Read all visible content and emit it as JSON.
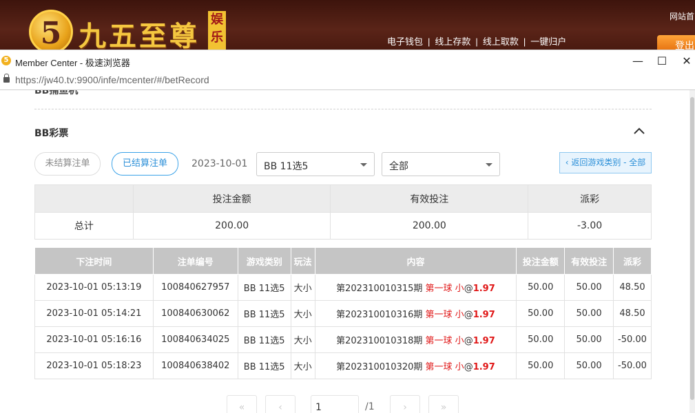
{
  "site": {
    "logo_digit": "5",
    "logo_text": "九五至尊",
    "logo_sub": "娱乐",
    "links": [
      "电子钱包",
      "线上存款",
      "线上取款",
      "一键归户"
    ],
    "link_sep": "|",
    "home_label": "网站首",
    "login_label": "登出"
  },
  "browser": {
    "title": "Member Center - 极速浏览器",
    "url_host": "https://jw40.tv",
    "url_rest": ":9900/infe/mcenter/#/betRecord",
    "minimize": "—",
    "maximize": "☐",
    "close": "✕"
  },
  "page": {
    "prev_section": "BB捕鱼机",
    "section_title": "BB彩票",
    "filters": {
      "unsettled_label": "未结算注单",
      "settled_label": "已结算注单",
      "date": "2023-10-01",
      "game_select": "BB 11选5",
      "type_select": "全部",
      "back_label": "‹ 返回游戏类别 - 全部"
    },
    "summary": {
      "headers": [
        "",
        "投注金额",
        "有效投注",
        "派彩"
      ],
      "row": {
        "label": "总计",
        "bet": "200.00",
        "valid": "200.00",
        "payout": "-3.00"
      }
    },
    "records": {
      "headers": [
        "下注时间",
        "注单编号",
        "游戏类别",
        "玩法",
        "内容",
        "投注金额",
        "有效投注",
        "派彩"
      ],
      "rows": [
        {
          "time": "2023-10-01 05:13:19",
          "id": "100840627957",
          "game": "BB 11选5",
          "play": "大小",
          "period": "第202310010315期",
          "pick": "第一球 小",
          "at": "@",
          "odds": "1.97",
          "bet": "50.00",
          "valid": "50.00",
          "payout": "48.50"
        },
        {
          "time": "2023-10-01 05:14:21",
          "id": "100840630062",
          "game": "BB 11选5",
          "play": "大小",
          "period": "第202310010316期",
          "pick": "第一球 小",
          "at": "@",
          "odds": "1.97",
          "bet": "50.00",
          "valid": "50.00",
          "payout": "48.50"
        },
        {
          "time": "2023-10-01 05:16:16",
          "id": "100840634025",
          "game": "BB 11选5",
          "play": "大小",
          "period": "第202310010318期",
          "pick": "第一球 小",
          "at": "@",
          "odds": "1.97",
          "bet": "50.00",
          "valid": "50.00",
          "payout": "-50.00"
        },
        {
          "time": "2023-10-01 05:18:23",
          "id": "100840638402",
          "game": "BB 11选5",
          "play": "大小",
          "period": "第202310010320期",
          "pick": "第一球 小",
          "at": "@",
          "odds": "1.97",
          "bet": "50.00",
          "valid": "50.00",
          "payout": "-50.00"
        }
      ]
    },
    "pagination": {
      "first": "«",
      "prev": "‹",
      "page_value": "1",
      "total": "/1",
      "next": "›",
      "last": "»"
    }
  },
  "colors": {
    "accent": "#2b8fd8",
    "negative": "#e04040",
    "header_gray": "#c5c5c5"
  }
}
